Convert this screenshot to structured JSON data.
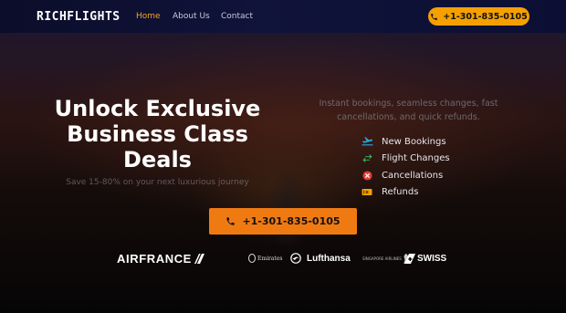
{
  "nav": {
    "logo": "RICHFLIGHTS",
    "links": [
      {
        "label": "Home",
        "active": true
      },
      {
        "label": "About Us",
        "active": false
      },
      {
        "label": "Contact",
        "active": false
      }
    ],
    "phone_label": "+1-301-835-0105",
    "phone_icon": "phone-icon",
    "accent_color": "#f5a000"
  },
  "hero": {
    "headline_lines": [
      "Unlock Exclusive",
      "Business Class",
      "Deals"
    ],
    "subline": "Save 15-80% on your next luxurious journey",
    "intro": "Instant bookings, seamless changes, fast cancellations, and quick refunds.",
    "services": [
      {
        "label": "New Bookings",
        "icon": "airplane-takeoff-icon",
        "color": "#2aa8e0"
      },
      {
        "label": "Flight Changes",
        "icon": "swap-arrows-icon",
        "color": "#3fbf5f"
      },
      {
        "label": "Cancellations",
        "icon": "cancel-circle-icon",
        "color": "#e53935"
      },
      {
        "label": "Refunds",
        "icon": "money-bill-icon",
        "color": "#f5a000"
      }
    ],
    "cta_label": "+1-301-835-0105",
    "cta_color": "#f07a12"
  },
  "airlines": [
    {
      "name": "AIRFRANCE"
    },
    {
      "name": "Emirates"
    },
    {
      "name": "Lufthansa"
    },
    {
      "name": "SINGAPORE AIRLINES"
    },
    {
      "name": "SWISS"
    }
  ]
}
